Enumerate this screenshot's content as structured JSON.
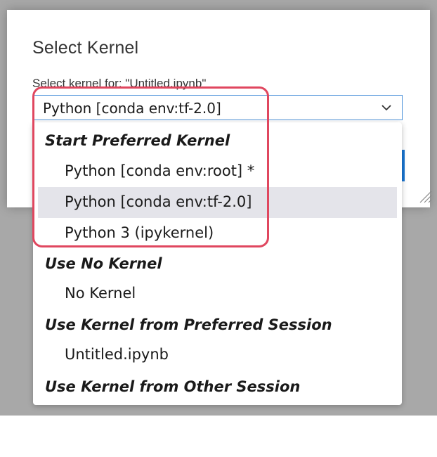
{
  "dialog": {
    "title": "Select Kernel",
    "label": "Select kernel for: \"Untitled.ipynb\"",
    "selected_value": "Python [conda env:tf-2.0]"
  },
  "dropdown": {
    "groups": [
      {
        "header": "Start Preferred Kernel",
        "options": [
          {
            "label": "Python [conda env:root] *"
          },
          {
            "label": "Python [conda env:tf-2.0]",
            "selected": true
          },
          {
            "label": "Python 3 (ipykernel)"
          }
        ]
      },
      {
        "header": "Use No Kernel",
        "options": [
          {
            "label": "No Kernel"
          }
        ]
      },
      {
        "header": "Use Kernel from Preferred Session",
        "options": [
          {
            "label": "Untitled.ipynb"
          }
        ]
      },
      {
        "header": "Use Kernel from Other Session",
        "options": []
      }
    ]
  },
  "colors": {
    "backdrop": "#a8a8a8",
    "focus_border": "#4a90d9",
    "selected_option_bg": "#e4e4ea",
    "highlight_ring": "#e0475f",
    "accept_button": "#1976d2"
  },
  "icons": {
    "select_chevron": "chevron-down-icon",
    "resize_grip": "resize-grip-icon"
  }
}
